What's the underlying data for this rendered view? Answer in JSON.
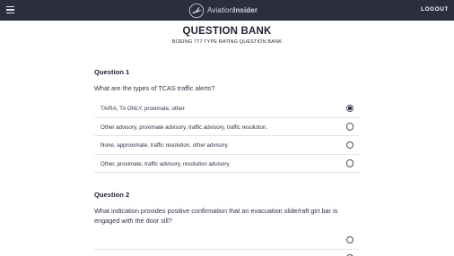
{
  "header": {
    "logo_text_a": "Aviation",
    "logo_text_b": "Insider",
    "logout_label": "LOGOUT"
  },
  "page": {
    "title": "QUESTION BANK",
    "subtitle": "BOEING 777 TYPE RATING QUESTION BANK"
  },
  "questions": [
    {
      "heading": "Question 1",
      "text": "What are the types of TCAS traffic alerts?",
      "options": [
        {
          "label": "TA/RA, TA ONLY, proximate, other.",
          "selected": true
        },
        {
          "label": "Other advisory, proximate advisory, traffic advisory, traffic resolution.",
          "selected": false
        },
        {
          "label": "None, approximate, traffic resolution, other advisory.",
          "selected": false
        },
        {
          "label": "Other, proximate, traffic advisory, resolution advisory.",
          "selected": false
        }
      ]
    },
    {
      "heading": "Question 2",
      "text": "What indication provides positive confirmation that an evacuation slide/raft girt bar is engaged with the door sill?",
      "options": [
        {
          "label": "",
          "selected": false
        },
        {
          "label": "",
          "selected": false
        }
      ]
    }
  ]
}
